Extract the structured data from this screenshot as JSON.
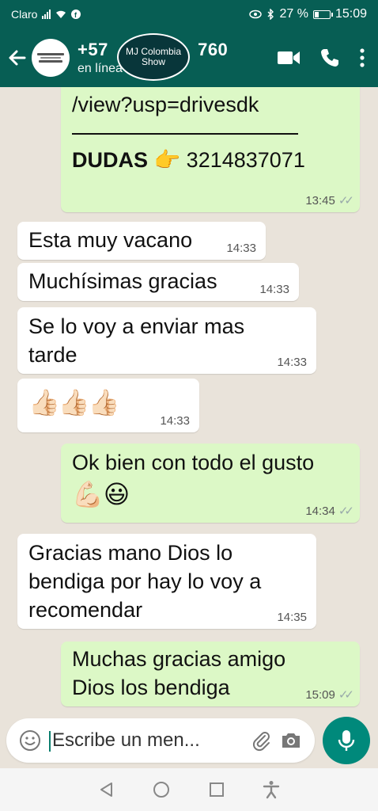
{
  "status_bar": {
    "carrier": "Claro",
    "battery": "27 %",
    "time": "15:09"
  },
  "header": {
    "contact_name_start": "+57",
    "contact_name_end": "760",
    "status": "en línea",
    "watermark_line1": "MJ Colombia",
    "watermark_line2": "Show"
  },
  "messages": [
    {
      "id": "m0",
      "direction": "out",
      "link": "/view?usp=drivesdk",
      "label": "DUDAS",
      "emoji": "👉",
      "phone": "3214837071",
      "time": "13:45"
    },
    {
      "id": "m1",
      "direction": "in",
      "text": "Esta muy vacano",
      "time": "14:33"
    },
    {
      "id": "m2",
      "direction": "in",
      "text": "Muchísimas gracias",
      "time": "14:33"
    },
    {
      "id": "m3",
      "direction": "in",
      "text": "Se lo voy a enviar mas tarde",
      "time": "14:33"
    },
    {
      "id": "m4",
      "direction": "in",
      "text": "👍🏻👍🏻👍🏻",
      "time": "14:33"
    },
    {
      "id": "m5",
      "direction": "out",
      "text": "Ok bien con todo el gusto",
      "emoji": "💪🏻😃",
      "time": "14:34"
    },
    {
      "id": "m6",
      "direction": "in",
      "text": "Gracias mano Dios lo bendiga por hay lo voy a recomendar",
      "time": "14:35"
    },
    {
      "id": "m7",
      "direction": "out",
      "text": "Muchas gracias amigo Dios los bendiga",
      "time": "15:09"
    }
  ],
  "input": {
    "placeholder": "Escribe un men..."
  },
  "icons": {
    "back": "arrow-left",
    "video": "video-camera",
    "call": "phone",
    "menu": "vertical-dots",
    "emoji": "smiley",
    "attach": "paperclip",
    "camera": "camera",
    "mic": "microphone"
  },
  "colors": {
    "header": "#075e54",
    "outgoing_bubble": "#dcf8c6",
    "incoming_bubble": "#ffffff",
    "mic_button": "#00897b"
  }
}
